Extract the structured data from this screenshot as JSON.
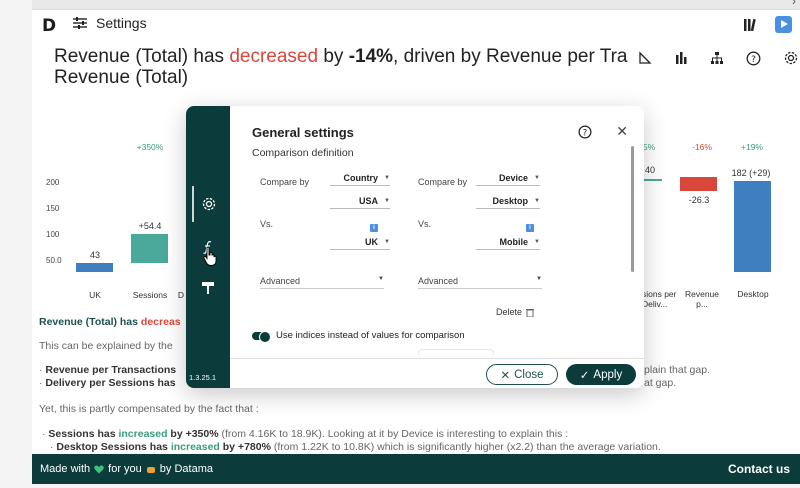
{
  "toolbar": {
    "logo": "D",
    "settings_label": "Settings"
  },
  "headline": {
    "part1": "Revenue (Total) has ",
    "decreased": "decreased",
    "part2": " by ",
    "pct": "-14%",
    "part3": ", driven by Revenue per Tra",
    "line2": "Revenue (Total)"
  },
  "chart_data": {
    "type": "bar",
    "yticks": [
      "200",
      "150",
      "100",
      "50.0"
    ],
    "left_categories": [
      "UK",
      "Sessions",
      "D"
    ],
    "left_values": [
      "43",
      "+54.4"
    ],
    "left_pct": [
      "+350%"
    ],
    "right_categories": [
      "sions per Deliv...",
      "Revenue p...",
      "Desktop"
    ],
    "right_values": [
      "40",
      "-26.3",
      "182 (+29)"
    ],
    "right_pct": [
      "5%",
      "-16%",
      "+19%"
    ],
    "colors": {
      "base": "#3f7fbf",
      "pos": "#4aa99a",
      "neg": "#d9473a"
    }
  },
  "narrative": {
    "summary_prefix": "Revenue (Total) has ",
    "summary_word": "decreas",
    "explained": "This can be explained by the",
    "b1": "Revenue per Transactions",
    "b2": "Delivery per Sessions has",
    "right1": "plain that gap.",
    "right2": "at gap.",
    "comp": "Yet, this is partly compensated by the fact that :",
    "s1_bold": "Sessions has ",
    "s1_word": "increased",
    "s1_rest": " by +350%",
    "s1_tail": " (from 4.16K to 18.9K). Looking at it by Device is  interesting to explain this :",
    "s2_bold": "Desktop Sessions has ",
    "s2_word": "increased",
    "s2_rest": " by +780%",
    "s2_tail": " (from 1.22K to 10.8K) which is significantly higher (x2.2) than the average variation."
  },
  "footer": {
    "made_with": "Made with",
    "for_you": "for you",
    "by": "by Datama",
    "contact": "Contact us"
  },
  "modal": {
    "version": "1.3.25.1",
    "title": "General settings",
    "subtitle": "Comparison definition",
    "left": {
      "compare_by": "Compare by",
      "dim": "Country",
      "a": "USA",
      "vs": "Vs.",
      "b": "UK",
      "advanced": "Advanced"
    },
    "right": {
      "compare_by": "Compare by",
      "dim": "Device",
      "a": "Desktop",
      "vs": "Vs.",
      "b": "Mobile",
      "advanced": "Advanced"
    },
    "delete": "Delete",
    "toggle_label": "Use indices instead of values for comparison",
    "close_btn": "Close",
    "apply_btn": "Apply"
  }
}
